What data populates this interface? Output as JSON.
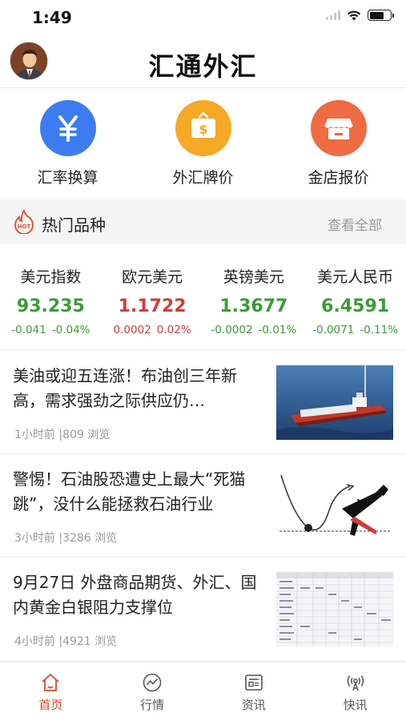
{
  "status_bar": {
    "time": "1:49"
  },
  "header": {
    "title": "汇通外汇"
  },
  "quick_actions": [
    {
      "label": "汇率换算",
      "icon": "yen-icon",
      "color": "#3d7cf0"
    },
    {
      "label": "外汇牌价",
      "icon": "dollar-board-icon",
      "color": "#f6a827"
    },
    {
      "label": "金店报价",
      "icon": "store-icon",
      "color": "#ee6b43"
    }
  ],
  "hot_section": {
    "title": "热门品种",
    "view_all": "查看全部",
    "badge": "HOT"
  },
  "quotes": [
    {
      "name": "美元指数",
      "price": "93.235",
      "change": "-0.041",
      "percent": "-0.04%",
      "trend": "down"
    },
    {
      "name": "欧元美元",
      "price": "1.1722",
      "change": "0.0002",
      "percent": "0.02%",
      "trend": "up"
    },
    {
      "name": "英镑美元",
      "price": "1.3677",
      "change": "-0.0002",
      "percent": "-0.01%",
      "trend": "down"
    },
    {
      "name": "美元人民币",
      "price": "6.4591",
      "change": "-0.0071",
      "percent": "-0.11%",
      "trend": "down"
    }
  ],
  "news": [
    {
      "title": "美油或迎五连涨！布油创三年新高，需求强劲之际供应仍…",
      "meta": "1小时前 |809 浏览",
      "thumb": "oil-tanker-image"
    },
    {
      "title": "警惕！石油股恐遭史上最大“死猫跳”，没什么能拯救石油行业",
      "meta": "3小时前 |3286 浏览",
      "thumb": "dead-cat-bounce-image"
    },
    {
      "title": "9月27日 外盘商品期货、外汇、国内黄金白银阻力支撑位",
      "meta": "4小时前 |4921 浏览",
      "thumb": "data-table-image"
    }
  ],
  "tabs": [
    {
      "label": "首页",
      "icon": "home-icon",
      "active": true
    },
    {
      "label": "行情",
      "icon": "market-icon",
      "active": false
    },
    {
      "label": "资讯",
      "icon": "news-icon",
      "active": false
    },
    {
      "label": "快讯",
      "icon": "broadcast-icon",
      "active": false
    }
  ],
  "colors": {
    "up": "#d33a3a",
    "down": "#3c9b3a",
    "active_tab": "#d24a2c"
  }
}
